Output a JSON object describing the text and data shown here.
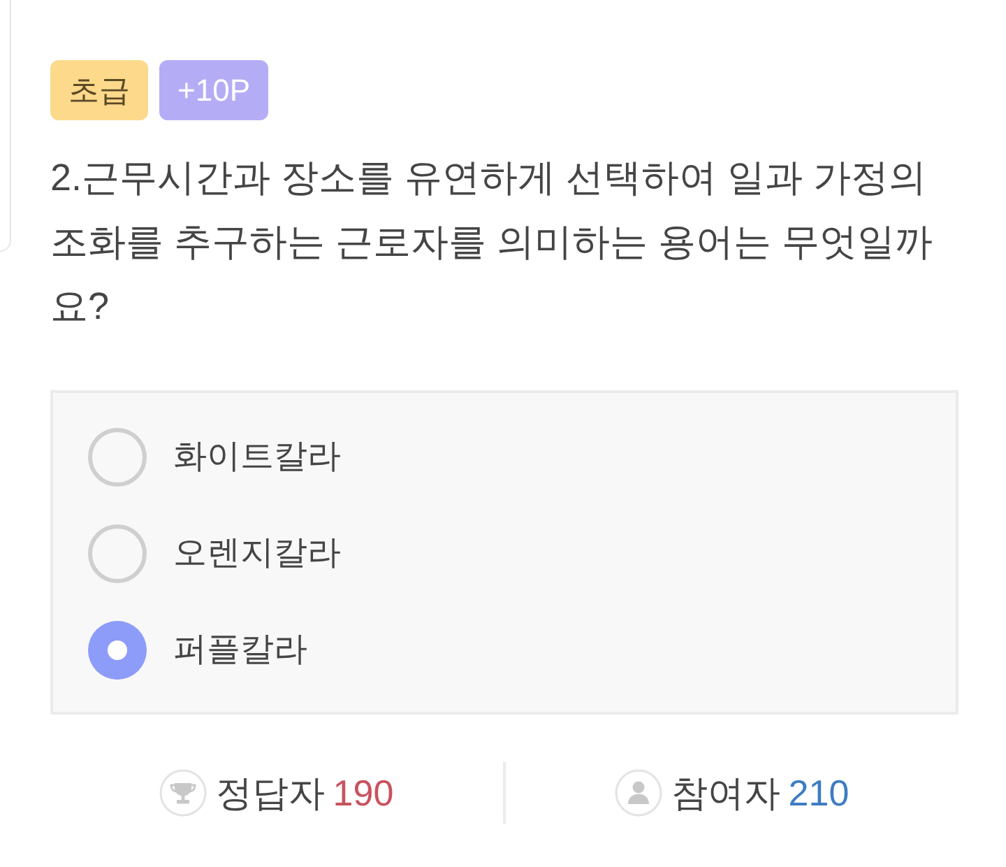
{
  "badges": [
    {
      "kind": "level",
      "label": "초급"
    },
    {
      "kind": "points",
      "label": "+10P"
    }
  ],
  "question": "2.근무시간과 장소를 유연하게 선택하여 일과 가정의 조화를 추구하는 근로자를 의미하는 용어는 무엇일까요?",
  "options": [
    {
      "label": "화이트칼라",
      "selected": false
    },
    {
      "label": "오렌지칼라",
      "selected": false
    },
    {
      "label": "퍼플칼라",
      "selected": true
    }
  ],
  "stats": [
    {
      "kind": "correct",
      "label": "정답자",
      "count": "190"
    },
    {
      "kind": "participants",
      "label": "참여자",
      "count": "210"
    }
  ]
}
